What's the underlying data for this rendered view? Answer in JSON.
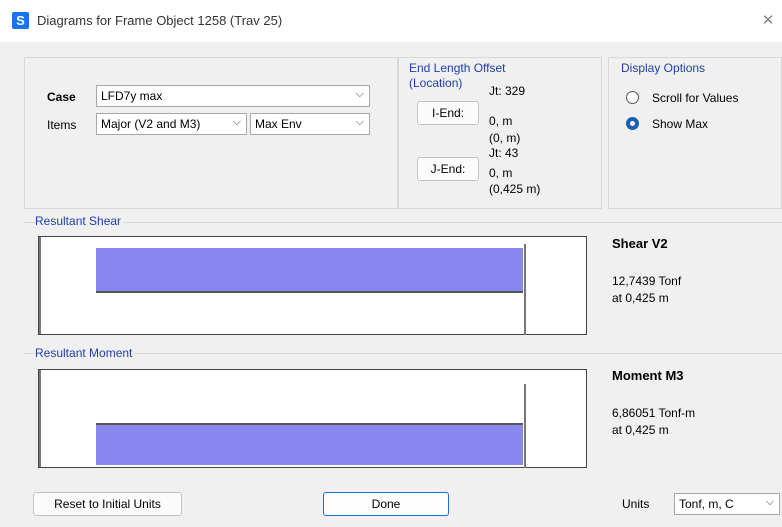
{
  "window": {
    "title": "Diagrams for Frame Object 1258  (Trav 25)",
    "app_icon_letter": "S"
  },
  "case": {
    "label": "Case",
    "value": "LFD7y max"
  },
  "items": {
    "label": "Items",
    "component": "Major (V2 and M3)",
    "envelope": "Max Env"
  },
  "end_offset": {
    "title": "End Length Offset",
    "subtitle": "(Location)",
    "i_end_label": "I-End:",
    "i_jt": "Jt:  329",
    "i_offset": "0, m",
    "i_location": "(0, m)",
    "j_end_label": "J-End:",
    "j_jt": "Jt:  43",
    "j_offset": "0, m",
    "j_location": "(0,425 m)"
  },
  "display_options": {
    "title": "Display Options",
    "scroll_label": "Scroll for Values",
    "showmax_label": "Show Max",
    "selected": "Show Max"
  },
  "shear": {
    "section_title": "Resultant Shear",
    "heading": "Shear V2",
    "value": "12,7439 Tonf",
    "location": "at 0,425 m",
    "fraction_of_length": 1.0
  },
  "moment": {
    "section_title": "Resultant Moment",
    "heading": "Moment M3",
    "value": "6,86051 Tonf-m",
    "location": "at 0,425 m",
    "fraction_of_length": 1.0
  },
  "footer": {
    "reset_label": "Reset to Initial Units",
    "done_label": "Done",
    "units_label": "Units",
    "units_value": "Tonf, m, C"
  },
  "colors": {
    "diagram_fill": "#8888f0",
    "accent": "#1f3fa8"
  }
}
